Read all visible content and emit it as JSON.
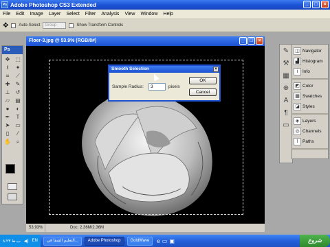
{
  "app": {
    "title": "Adobe Photoshop CS3 Extended",
    "logo": "Ps",
    "title_icon": "photoshop-icon"
  },
  "menu": [
    "File",
    "Edit",
    "Image",
    "Layer",
    "Select",
    "Filter",
    "Analysis",
    "View",
    "Window",
    "Help"
  ],
  "options": {
    "auto_select_label": "Auto-Select",
    "auto_select_value": "Group",
    "show_transform_label": "Show Transform Controls"
  },
  "document": {
    "title": "Floer-3.jpg @ 53.9% (RGB/8#)",
    "zoom": "53.93%",
    "doc_size": "Doc: 2.36M/2.36M"
  },
  "dialog": {
    "title": "Smooth Selection",
    "radius_label": "Sample Radius:",
    "radius_value": "3",
    "unit": "pixels",
    "ok": "OK",
    "cancel": "Cancel"
  },
  "panels": [
    [
      {
        "label": "Navigator",
        "icon": "navigator-icon"
      },
      {
        "label": "Histogram",
        "icon": "histogram-icon"
      },
      {
        "label": "Info",
        "icon": "info-icon"
      }
    ],
    [
      {
        "label": "Color",
        "icon": "color-icon"
      },
      {
        "label": "Swatches",
        "icon": "swatches-icon"
      },
      {
        "label": "Styles",
        "icon": "styles-icon"
      }
    ],
    [
      {
        "label": "Layers",
        "icon": "layers-icon"
      },
      {
        "label": "Channels",
        "icon": "channels-icon"
      },
      {
        "label": "Paths",
        "icon": "paths-icon"
      }
    ]
  ],
  "taskbar": {
    "clock": "۸:۲۳ ب.ظ",
    "lang": "EN",
    "app_button_1": "التعليم الشفا في...",
    "app_button_2": "Adobe Photoshop",
    "app_button_3": "GoldWave",
    "start": "شروع"
  },
  "colors": {
    "title_blue": "#1c50d0",
    "dialog_bg": "#ece9d8",
    "taskbar": "#2460d9"
  }
}
